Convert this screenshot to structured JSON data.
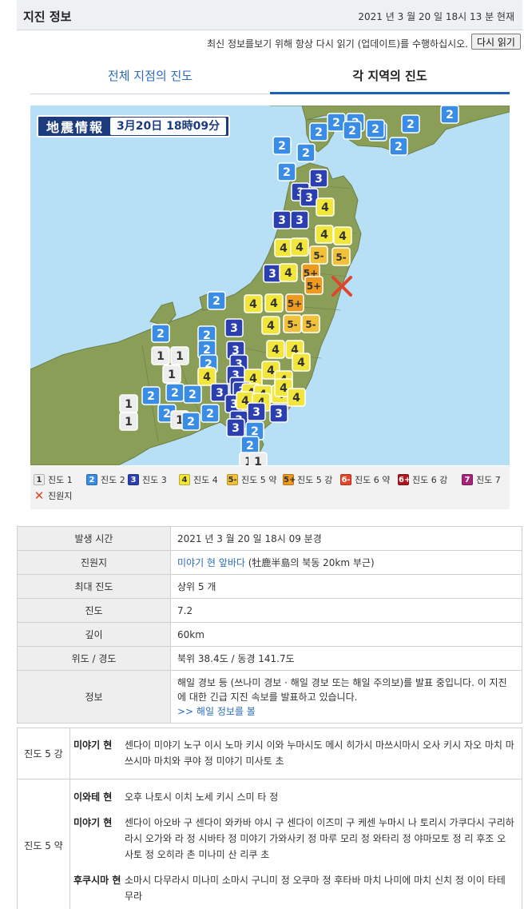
{
  "header": {
    "title": "지진 정보",
    "timestamp": "2021 년 3 월 20 일 18시 13 분 현재"
  },
  "reload": {
    "note": "최신 정보를보기 위해 항상 다시 읽기 (업데이트)를 수행하십시오.",
    "button": "다시 읽기"
  },
  "tabs": {
    "all": "전체 지점의 진도",
    "region": "각 지역의 진도"
  },
  "map": {
    "badge_title": "地震情報",
    "badge_date": "3月20日 18時09分",
    "land_color": "#8a9e58",
    "sea_color": "#b7dff5",
    "epicenter_icon": "cross-icon",
    "markers": [
      {
        "v": "2",
        "c": "#3a8de6"
      },
      {
        "v": "2",
        "c": "#3a8de6"
      },
      {
        "v": "2",
        "c": "#3a8de6"
      },
      {
        "v": "2",
        "c": "#3a8de6"
      }
    ]
  },
  "legend": [
    {
      "sw": "1",
      "label": "진도 1",
      "bg": "#ededed",
      "fg": "#333"
    },
    {
      "sw": "2",
      "label": "진도 2",
      "bg": "#3a8de6",
      "fg": "#fff"
    },
    {
      "sw": "3",
      "label": "진도 3",
      "bg": "#2c3fb0",
      "fg": "#fff"
    },
    {
      "sw": "4",
      "label": "진도 4",
      "bg": "#f3e63a",
      "fg": "#333"
    },
    {
      "sw": "5-",
      "label": "진도 5 약",
      "bg": "#f2c13a",
      "fg": "#333"
    },
    {
      "sw": "5+",
      "label": "진도 5 강",
      "bg": "#ee9a1f",
      "fg": "#333"
    },
    {
      "sw": "6-",
      "label": "진도 6 약",
      "bg": "#e8452a",
      "fg": "#fff"
    },
    {
      "sw": "6+",
      "label": "진도 6 강",
      "bg": "#b0161e",
      "fg": "#fff"
    },
    {
      "sw": "7",
      "label": "진도 7",
      "bg": "#a3267a",
      "fg": "#fff"
    },
    {
      "sw": "✕",
      "label": "진원지",
      "bg": "transparent",
      "fg": "#e0442a"
    }
  ],
  "info": {
    "time_k": "발생 시간",
    "time_v": "2021 년 3 월 20 일 18시 09 분경",
    "epi_k": "진원지",
    "epi_link": "미야기 현 앞바다",
    "epi_rest": " (牡鹿半島의 북동 20km 부근)",
    "max_k": "최대 진도",
    "max_v": "상위 5 개",
    "mag_k": "진도",
    "mag_v": "7.2",
    "depth_k": "깊이",
    "depth_v": "60km",
    "latlon_k": "위도 / 경도",
    "latlon_v": "북위 38.4도 / 동경 141.7도",
    "note_k": "정보",
    "note_1": "해일 경보 등 (쓰나미 경보 · 해일 경보 또는 해일 주의보)를 발표 중입니다. 이 지진에 대한 긴급 지진 속보를 발표하고 있습니다.",
    "note_link": ">> 해일 정보를 볼"
  },
  "areas": {
    "lvl_5plus": "진도 5 강",
    "p1_name": "미야기 현",
    "p1_cities": "센다이 미야기 노구 이시 노마 키시 이와 누마시도 메시 히가시 마쓰시마시 오사 키시 자오 마치 마쓰시마 마치와 쿠야 정 미야기 미사토 초",
    "lvl_5minus": "진도 5 약",
    "p2_name": "이와테 현",
    "p2_cities": "오후 나토시 이치 노세 키시 스미 타 정",
    "p3_name": "미야기 현",
    "p3_cities": "센다이 아오바 구 센다이 와카바 야시 구 센다이 이즈미 구 케센 누마시 나 토리시 가쿠다시 구리하라시 오가와 라 정 시바타 정 미야기 가와사키 정 마루 모리 정 와타리 정 야마모토 정 리 후조 오 사토 정 오히라 촌 미나미 산 리쿠 초",
    "p4_name": "후쿠시마 현",
    "p4_cities": "소마시 다무라시 미나미 소마시 구니미 정 오쿠마 정 후타바 마치 나미에 마치 신치 정 이이 타테 무라"
  }
}
